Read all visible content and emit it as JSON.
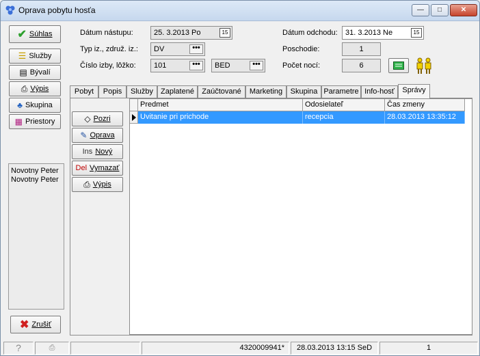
{
  "window": {
    "title": "Oprava pobytu hosťa",
    "minimize": "—",
    "maximize": "□",
    "close": "✕"
  },
  "left_buttons": {
    "suhlas": "Súhlas",
    "sluzby": "Služby",
    "byvali": "Bývalí",
    "vypis": "Výpis",
    "skupina": "Skupina",
    "priestory": "Priestory",
    "zrusit": "Zrušiť"
  },
  "guests": [
    "Novotny Peter",
    "Novotny Peter"
  ],
  "form": {
    "datum_nastupu_label": "Dátum nástupu:",
    "datum_nastupu_value": "25. 3.2013  Po",
    "typ_label": "Typ iz., združ. iz.:",
    "typ_value": "DV",
    "cislo_label": "Číslo izby, lôžko:",
    "cislo_value": "101",
    "lozko_value": "BED",
    "datum_odchodu_label": "Dátum odchodu:",
    "datum_odchodu_value": "31. 3.2013  Ne",
    "poschodie_label": "Poschodie:",
    "poschodie_value": "1",
    "pocet_noci_label": "Počet nocí:",
    "pocet_noci_value": "6",
    "calendar_glyph": "15",
    "dots_glyph": "•••"
  },
  "tabs": [
    "Pobyt",
    "Popis",
    "Služby",
    "Zaplatené",
    "Zaúčtované",
    "Marketing",
    "Skupina",
    "Parametre",
    "Info-hosť",
    "Správy"
  ],
  "message_buttons": {
    "pozri": "Pozri",
    "oprava": "Oprava",
    "novy_prefix": "Ins",
    "novy": "Nový",
    "vymazat_prefix": "Del",
    "vymazat": "Vymazať",
    "vypis": "Výpis"
  },
  "grid": {
    "columns": [
      "Predmet",
      "Odosielateľ",
      "Čas zmeny"
    ],
    "rows": [
      {
        "predmet": "Uvitanie pri prichode",
        "odosielatel": "recepcia",
        "cas": "28.03.2013 13:35:12"
      }
    ]
  },
  "status": {
    "id": "4320009941*",
    "datetime": "28.03.2013 13:15 SeD",
    "count": "1"
  }
}
